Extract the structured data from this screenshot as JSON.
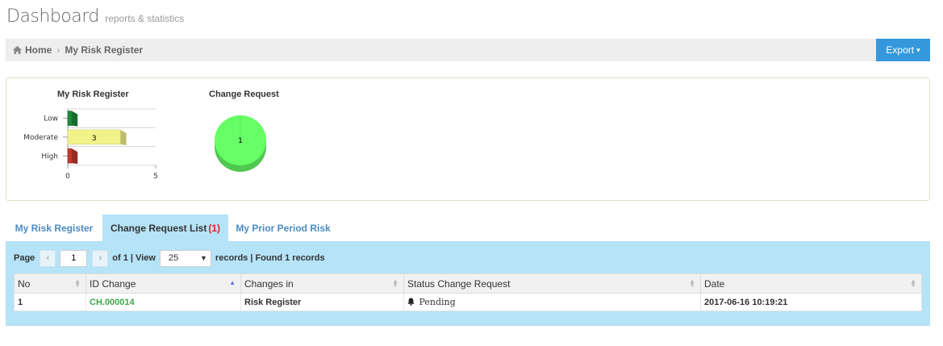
{
  "header": {
    "title": "Dashboard",
    "subtitle": "reports & statistics"
  },
  "breadcrumb": {
    "home": "Home",
    "current": "My Risk Register",
    "home_icon": "home-icon",
    "sep_icon": "chevron-right-icon"
  },
  "export": {
    "label": "Export",
    "color": "#3598dc"
  },
  "charts": {
    "risk_title": "My Risk Register",
    "change_title": "Change Request"
  },
  "chart_data": [
    {
      "type": "bar",
      "title": "My Risk Register",
      "orientation": "horizontal",
      "categories": [
        "Low",
        "Moderate",
        "High"
      ],
      "values": [
        0,
        3,
        0
      ],
      "data_labels": [
        "",
        "3",
        ""
      ],
      "colors": [
        "#1e8a3c",
        "#f2f28a",
        "#c0392b"
      ],
      "xlim": [
        0,
        5
      ],
      "x_ticks": [
        "0",
        "5"
      ]
    },
    {
      "type": "pie",
      "title": "Change Request",
      "categories": [
        ""
      ],
      "values": [
        1
      ],
      "data_labels": [
        "1"
      ],
      "colors": [
        "#66ff66"
      ]
    }
  ],
  "tabs": [
    {
      "label": "My Risk Register",
      "count": ""
    },
    {
      "label": "Change Request List",
      "count": "(1)"
    },
    {
      "label": "My Prior Period Risk",
      "count": ""
    }
  ],
  "pager": {
    "page_label": "Page",
    "page_value": "1",
    "of_label": "of 1 | View",
    "per_page": "25",
    "records_label": "records | Found 1 records",
    "prev_icon": "chevron-left-icon",
    "next_icon": "chevron-right-icon"
  },
  "table": {
    "columns": [
      "No",
      "ID Change",
      "Changes in",
      "Status Change Request",
      "Date"
    ],
    "rows": [
      {
        "no": "1",
        "id": "CH.000014",
        "changes_in": "Risk Register",
        "status": "Pending",
        "status_icon": "bell-icon",
        "date": "2017-06-16 10:19:21"
      }
    ]
  }
}
